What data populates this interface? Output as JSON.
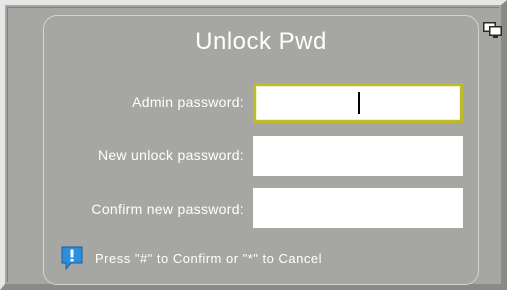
{
  "dialog": {
    "title": "Unlock Pwd",
    "fields": [
      {
        "label": "Admin password:",
        "value": ""
      },
      {
        "label": "New unlock password:",
        "value": ""
      },
      {
        "label": "Confirm new password:",
        "value": ""
      }
    ],
    "hint": "Press \"#\" to Confirm or \"*\" to Cancel"
  },
  "icons": {
    "hint": "info-exclamation-icon",
    "display": "display-icon"
  },
  "colors": {
    "background": "#a6a6a2",
    "focus_border": "#bcbc2a",
    "text": "#ffffff",
    "hint_icon": "#2b8fe0"
  }
}
